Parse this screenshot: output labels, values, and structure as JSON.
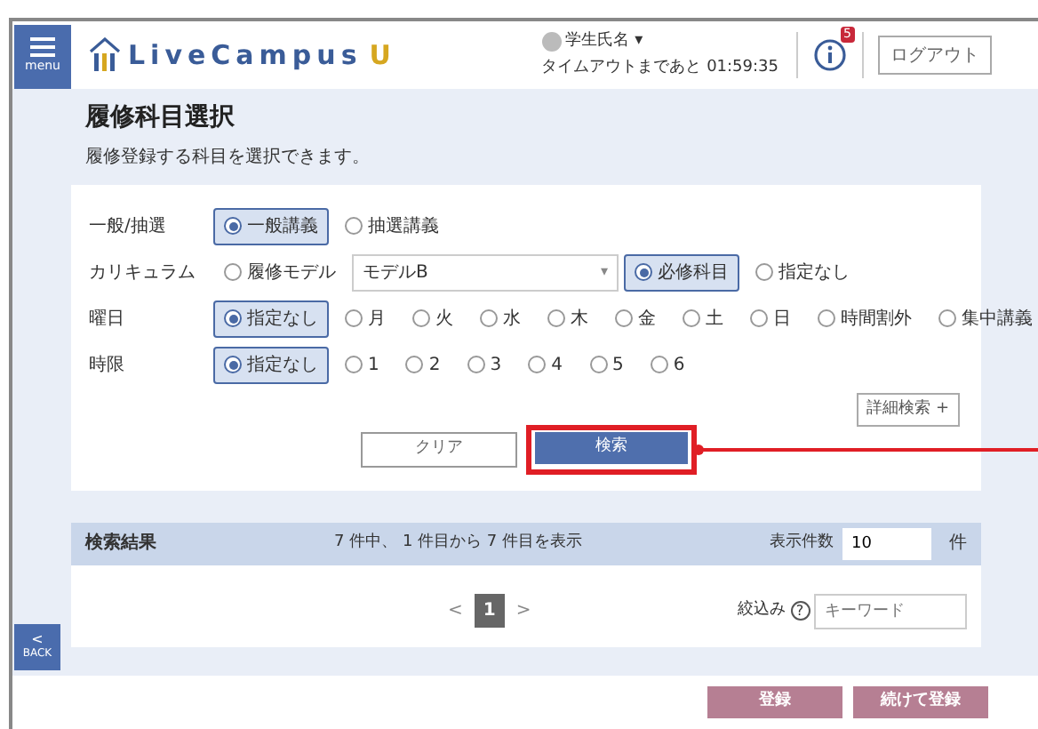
{
  "header": {
    "menu_label": "menu",
    "logo_text": "LiveCampus",
    "logo_mark": "U",
    "user_name": "学生氏名",
    "user_caret": "▾",
    "timeout": "タイムアウトまであと 01:59:35",
    "notification_badge": "5",
    "logout": "ログアウト"
  },
  "page": {
    "title": "履修科目選択",
    "subtitle": "履修登録する科目を選択できます。"
  },
  "filters": [
    {
      "label": "一般/抽選",
      "items": [
        {
          "kind": "radio",
          "text": "一般講義",
          "selected": true
        },
        {
          "kind": "radio",
          "text": "抽選講義",
          "selected": false
        }
      ]
    },
    {
      "label": "カリキュラム",
      "items": [
        {
          "kind": "radio",
          "text": "履修モデル",
          "selected": false
        },
        {
          "kind": "select",
          "value": "モデルB",
          "caret": "▾"
        },
        {
          "kind": "radio",
          "text": "必修科目",
          "selected": true
        },
        {
          "kind": "radio",
          "text": "指定なし",
          "selected": false
        }
      ]
    },
    {
      "label": "曜日",
      "items": [
        {
          "kind": "radio",
          "text": "指定なし",
          "selected": true
        },
        {
          "kind": "radio",
          "text": "月",
          "selected": false
        },
        {
          "kind": "radio",
          "text": "火",
          "selected": false
        },
        {
          "kind": "radio",
          "text": "水",
          "selected": false
        },
        {
          "kind": "radio",
          "text": "木",
          "selected": false
        },
        {
          "kind": "radio",
          "text": "金",
          "selected": false
        },
        {
          "kind": "radio",
          "text": "土",
          "selected": false
        },
        {
          "kind": "radio",
          "text": "日",
          "selected": false
        },
        {
          "kind": "radio",
          "text": "時間割外",
          "selected": false
        },
        {
          "kind": "radio",
          "text": "集中講義",
          "selected": false
        }
      ]
    },
    {
      "label": "時限",
      "items": [
        {
          "kind": "radio",
          "text": "指定なし",
          "selected": true
        },
        {
          "kind": "radio",
          "text": "1",
          "selected": false
        },
        {
          "kind": "radio",
          "text": "2",
          "selected": false
        },
        {
          "kind": "radio",
          "text": "3",
          "selected": false
        },
        {
          "kind": "radio",
          "text": "4",
          "selected": false
        },
        {
          "kind": "radio",
          "text": "5",
          "selected": false
        },
        {
          "kind": "radio",
          "text": "6",
          "selected": false
        }
      ]
    }
  ],
  "advanced_search": "詳細検索 +",
  "clear_button": "クリア",
  "search_button": "検索",
  "results": {
    "title": "検索結果",
    "summary": "7 件中、 1 件目から 7 件目を表示",
    "per_page_label": "表示件数",
    "per_page_value": "10",
    "per_page_unit": "件",
    "pagination": [
      {
        "text": "<",
        "kind": "arrow",
        "selected": false
      },
      {
        "text": "1",
        "kind": "page",
        "selected": true
      },
      {
        "text": ">",
        "kind": "arrow",
        "selected": false
      }
    ],
    "filter_label": "絞込み",
    "help": "?",
    "keyword_placeholder": "キーワード"
  },
  "back_label": "BACK",
  "back_arrow": "<",
  "footer_buttons": [
    "登録",
    "続けて登録"
  ]
}
